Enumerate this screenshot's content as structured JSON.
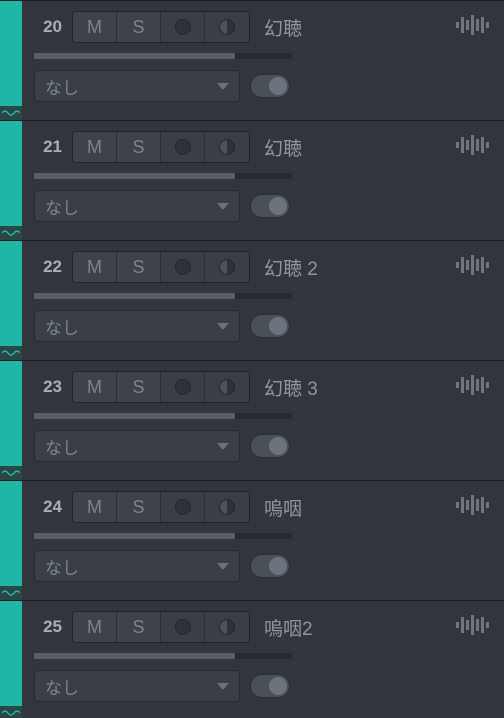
{
  "colors": {
    "strip": "#1fb6a7"
  },
  "dropdown_default": "なし",
  "labels": {
    "mute": "M",
    "solo": "S"
  },
  "tracks": [
    {
      "num": "20",
      "name": "幻聴",
      "volume_pct": 78,
      "dropdown": "なし"
    },
    {
      "num": "21",
      "name": "幻聴",
      "volume_pct": 78,
      "dropdown": "なし"
    },
    {
      "num": "22",
      "name": "幻聴 2",
      "volume_pct": 78,
      "dropdown": "なし"
    },
    {
      "num": "23",
      "name": "幻聴 3",
      "volume_pct": 78,
      "dropdown": "なし"
    },
    {
      "num": "24",
      "name": "嗚咽",
      "volume_pct": 78,
      "dropdown": "なし"
    },
    {
      "num": "25",
      "name": "嗚咽2",
      "volume_pct": 78,
      "dropdown": "なし"
    }
  ]
}
